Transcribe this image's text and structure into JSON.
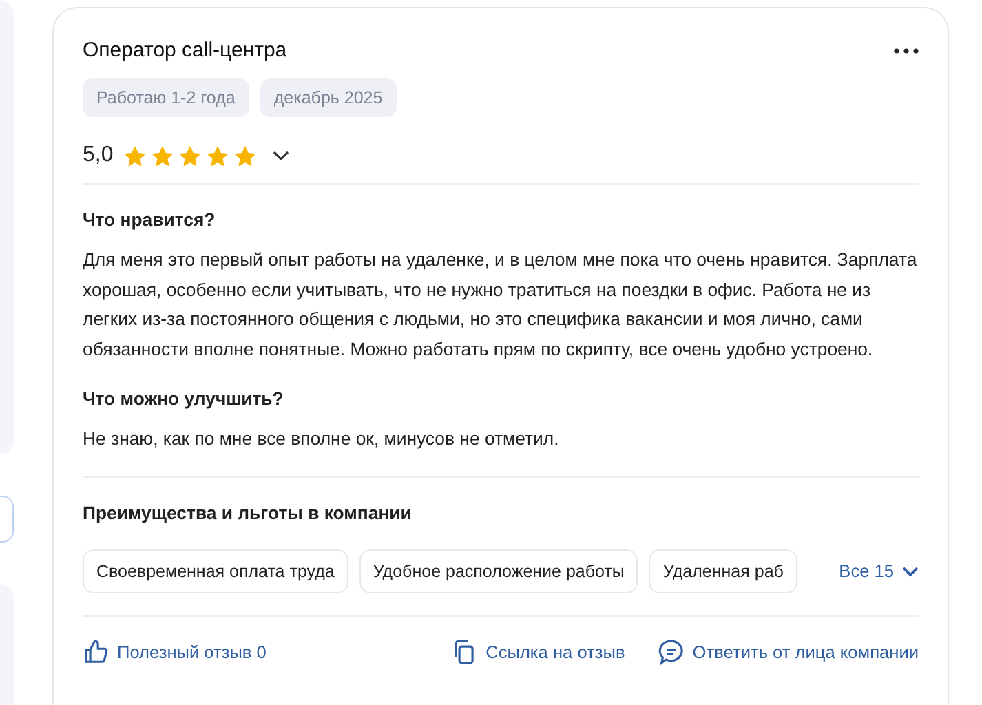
{
  "review": {
    "title": "Оператор call-центра",
    "tags": [
      "Работаю 1-2 года",
      "декабрь 2025"
    ],
    "rating": "5,0",
    "stars": 5,
    "sections": [
      {
        "heading": "Что нравится?",
        "text": "Для меня это первый опыт работы на удаленке, и в целом мне пока что очень нравится. Зарплата хорошая, особенно если учитывать, что не нужно тратиться на поездки в офис. Работа не из легких из-за постоянного общения с людьми, но это специфика вакансии и моя лично, сами обязанности вполне понятные. Можно работать прям по скрипту, все очень удобно устроено."
      },
      {
        "heading": "Что можно улучшить?",
        "text": "Не знаю, как по мне все вполне ок, минусов не отметил."
      }
    ],
    "benefits_title": "Преимущества и льготы в компании",
    "benefits": [
      "Своевременная оплата труда",
      "Удобное расположение работы",
      "Удаленная раб"
    ],
    "benefits_more": "Все 15",
    "actions": [
      {
        "kind": "like",
        "label": "Полезный отзыв 0"
      },
      {
        "kind": "link",
        "label": "Ссылка на отзыв"
      },
      {
        "kind": "reply",
        "label": "Ответить от лица компании"
      }
    ]
  }
}
